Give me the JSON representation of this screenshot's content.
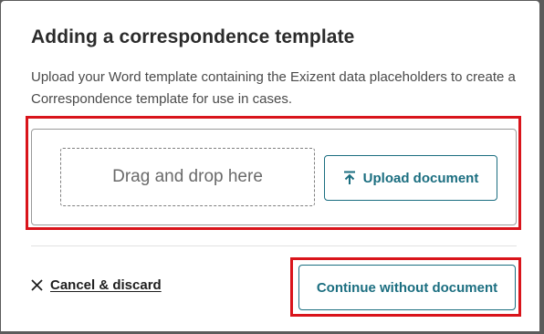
{
  "dialog": {
    "title": "Adding a correspondence template",
    "description": "Upload your Word template containing the Exizent data placeholders to create a Correspondence template for use in cases."
  },
  "upload": {
    "dropzone_label": "Drag and drop here",
    "upload_button_label": "Upload document",
    "upload_icon": "upload-icon"
  },
  "footer": {
    "cancel_label": "Cancel & discard",
    "cancel_icon": "close-icon",
    "continue_label": "Continue without document"
  },
  "colors": {
    "accent": "#1b6e80",
    "annotation_highlight": "#d9141b"
  }
}
